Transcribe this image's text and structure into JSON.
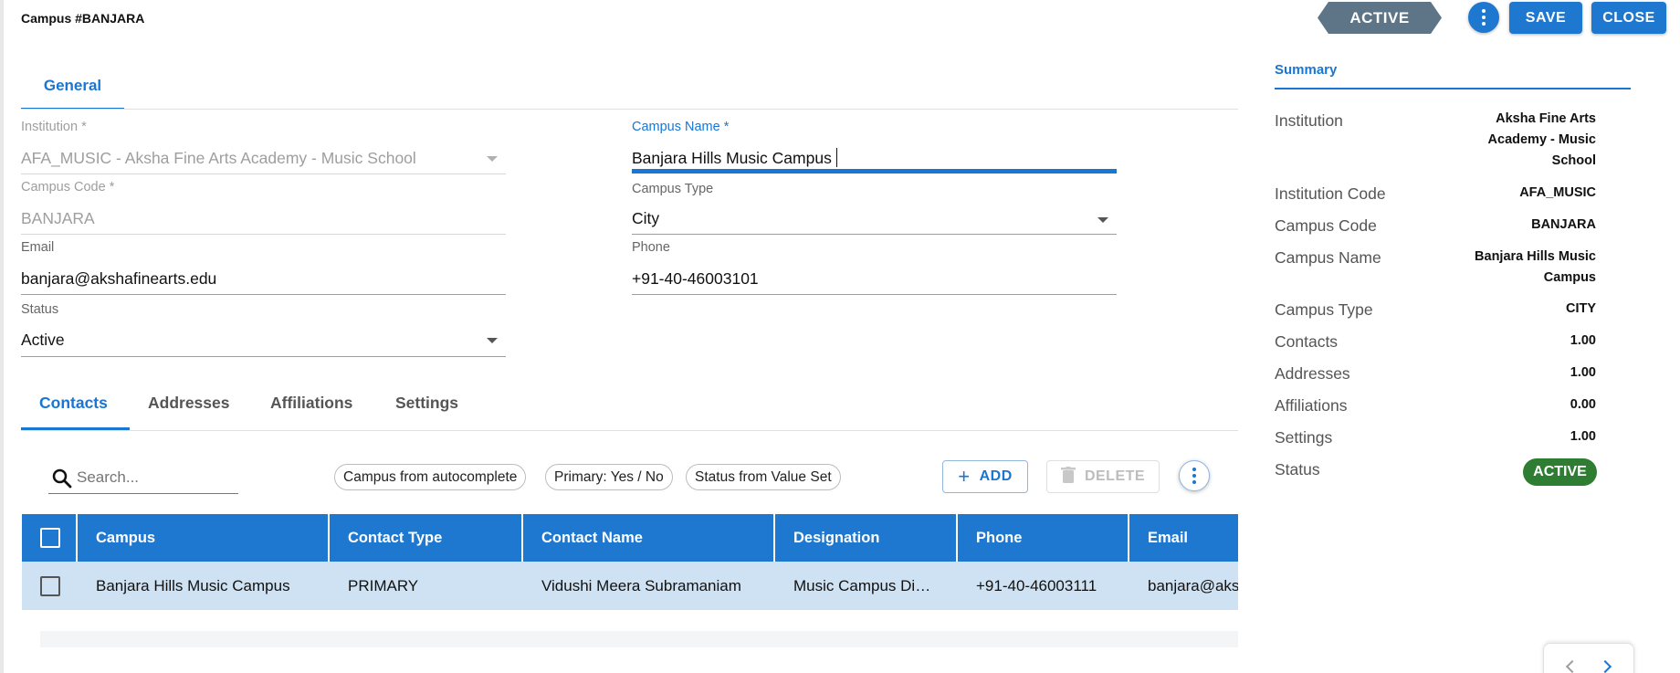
{
  "header": {
    "title": "Campus #BANJARA",
    "status_tag": "ACTIVE",
    "save_label": "SAVE",
    "close_label": "CLOSE"
  },
  "general_tab": {
    "label": "General"
  },
  "form": {
    "institution": {
      "label": "Institution *",
      "value": "AFA_MUSIC - Aksha Fine Arts Academy - Music School"
    },
    "campus_name": {
      "label": "Campus Name *",
      "value": "Banjara Hills Music Campus"
    },
    "campus_code": {
      "label": "Campus Code *",
      "value": "BANJARA"
    },
    "campus_type": {
      "label": "Campus Type",
      "value": "City"
    },
    "email": {
      "label": "Email",
      "value": "banjara@akshafinearts.edu"
    },
    "phone": {
      "label": "Phone",
      "value": "+91-40-46003101"
    },
    "status": {
      "label": "Status",
      "value": "Active"
    }
  },
  "sub_tabs": [
    {
      "label": "Contacts",
      "active": true
    },
    {
      "label": "Addresses",
      "active": false
    },
    {
      "label": "Affiliations",
      "active": false
    },
    {
      "label": "Settings",
      "active": false
    }
  ],
  "toolbar": {
    "search_placeholder": "Search...",
    "chips": [
      "Campus from autocomplete",
      "Primary: Yes / No",
      "Status from Value Set"
    ],
    "add_label": "ADD",
    "delete_label": "DELETE"
  },
  "table": {
    "columns": [
      "Campus",
      "Contact Type",
      "Contact Name",
      "Designation",
      "Phone",
      "Email"
    ],
    "rows": [
      [
        "Banjara Hills Music Campus",
        "PRIMARY",
        "Vidushi Meera Subramaniam",
        "Music Campus Di…",
        "+91-40-46003111",
        "banjara@aks"
      ]
    ]
  },
  "summary": {
    "tab_label": "Summary",
    "institution": {
      "label": "Institution",
      "value_lines": [
        "Aksha Fine Arts",
        "Academy - Music",
        "School"
      ]
    },
    "institution_code": {
      "label": "Institution Code",
      "value": "AFA_MUSIC"
    },
    "campus_code": {
      "label": "Campus Code",
      "value": "BANJARA"
    },
    "campus_name": {
      "label": "Campus Name",
      "value_lines": [
        "Banjara Hills Music",
        "Campus"
      ]
    },
    "campus_type": {
      "label": "Campus Type",
      "value": "CITY"
    },
    "contacts": {
      "label": "Contacts",
      "value": "1.00"
    },
    "addresses": {
      "label": "Addresses",
      "value": "1.00"
    },
    "affiliations": {
      "label": "Affiliations",
      "value": "0.00"
    },
    "settings": {
      "label": "Settings",
      "value": "1.00"
    },
    "status": {
      "label": "Status",
      "value": "ACTIVE"
    }
  },
  "colors": {
    "primary": "#1e78d0",
    "status_tag": "#5d7587",
    "active_badge": "#2e7d32",
    "row_highlight": "#cfe2f3"
  }
}
